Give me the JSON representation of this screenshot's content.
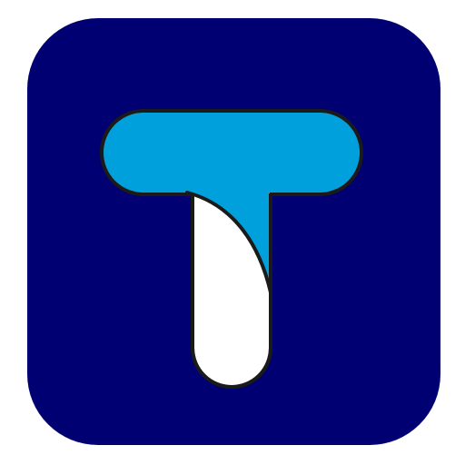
{
  "app_icon": {
    "letter": "T",
    "colors": {
      "background": "#000072",
      "bar": "#00A0DC",
      "stem": "#FFFFFF",
      "outline": "#1A1A1A",
      "frame": "#FFFFFF"
    }
  }
}
